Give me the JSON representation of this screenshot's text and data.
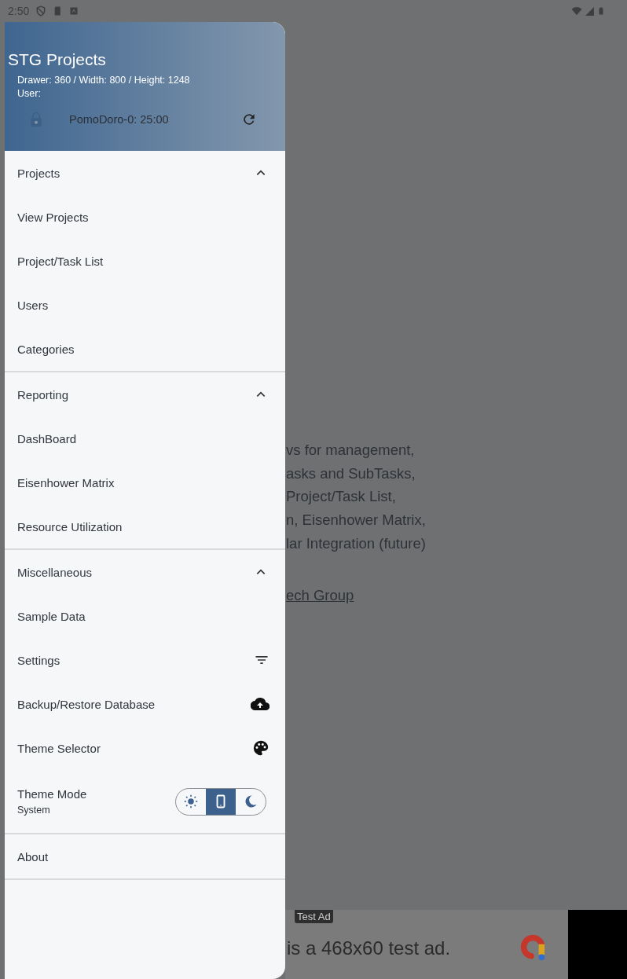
{
  "status_bar": {
    "time": "2:50"
  },
  "drawer": {
    "title": "STG Projects",
    "info": [
      "Drawer: 360 / Width: 800 / Height: 1248",
      "User:"
    ],
    "pomodoro": "PomoDoro-0: 25:00",
    "sections": [
      {
        "title": "Projects",
        "expanded": true,
        "items": [
          {
            "label": "View Projects",
            "kind": "plain"
          },
          {
            "label": "Project/Task List",
            "kind": "plain"
          },
          {
            "label": "Users",
            "kind": "plain"
          },
          {
            "label": "Categories",
            "kind": "plain"
          }
        ]
      },
      {
        "title": "Reporting",
        "expanded": true,
        "items": [
          {
            "label": "DashBoard",
            "kind": "plain"
          },
          {
            "label": "Eisenhower Matrix",
            "kind": "plain"
          },
          {
            "label": "Resource Utilization",
            "kind": "plain"
          }
        ]
      },
      {
        "title": "Miscellaneous",
        "expanded": true,
        "items": [
          {
            "label": "Sample Data",
            "kind": "plain"
          },
          {
            "label": "Settings",
            "kind": "filter"
          },
          {
            "label": "Backup/Restore Database",
            "kind": "upload"
          },
          {
            "label": "Theme Selector",
            "kind": "palette"
          },
          {
            "label": "Theme Mode",
            "kind": "theme_mode",
            "value": "System",
            "options": [
              {
                "kind": "light",
                "selected": false
              },
              {
                "kind": "system",
                "selected": true
              },
              {
                "kind": "dark",
                "selected": false
              }
            ]
          }
        ]
      }
    ],
    "about": "About"
  },
  "background": {
    "lines": [
      "vs for management,",
      "asks and SubTasks,",
      "Project/Task List,",
      "n, Eisenhower Matrix,",
      "lar Integration (future)"
    ],
    "link": "ech Group"
  },
  "ad": {
    "badge": "Test Ad",
    "text": "is a 468x60 test ad."
  }
}
